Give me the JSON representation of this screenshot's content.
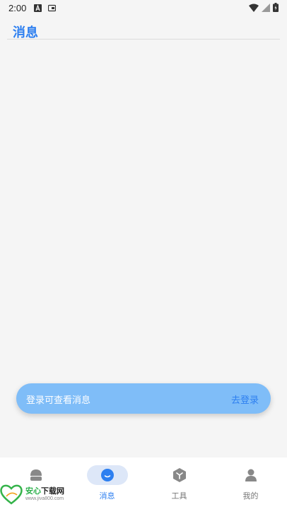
{
  "status_bar": {
    "time": "2:00"
  },
  "header": {
    "title": "消息"
  },
  "login_prompt": {
    "message": "登录可查看消息",
    "action": "去登录"
  },
  "bottom_nav": {
    "items": [
      {
        "label": "",
        "icon": "home-icon",
        "active": false
      },
      {
        "label": "消息",
        "icon": "message-icon",
        "active": true
      },
      {
        "label": "工具",
        "icon": "tools-box-icon",
        "active": false
      },
      {
        "label": "我的",
        "icon": "profile-icon",
        "active": false
      }
    ]
  },
  "watermark": {
    "brand_green": "安心",
    "brand_dark": "下载网",
    "url": "www.jiva800.com",
    "logo_text": "安心下载"
  },
  "colors": {
    "accent": "#2d7ff0",
    "banner": "#7fbdf8",
    "background": "#f5f5f5",
    "nav_active_pill": "#dde7f8"
  }
}
